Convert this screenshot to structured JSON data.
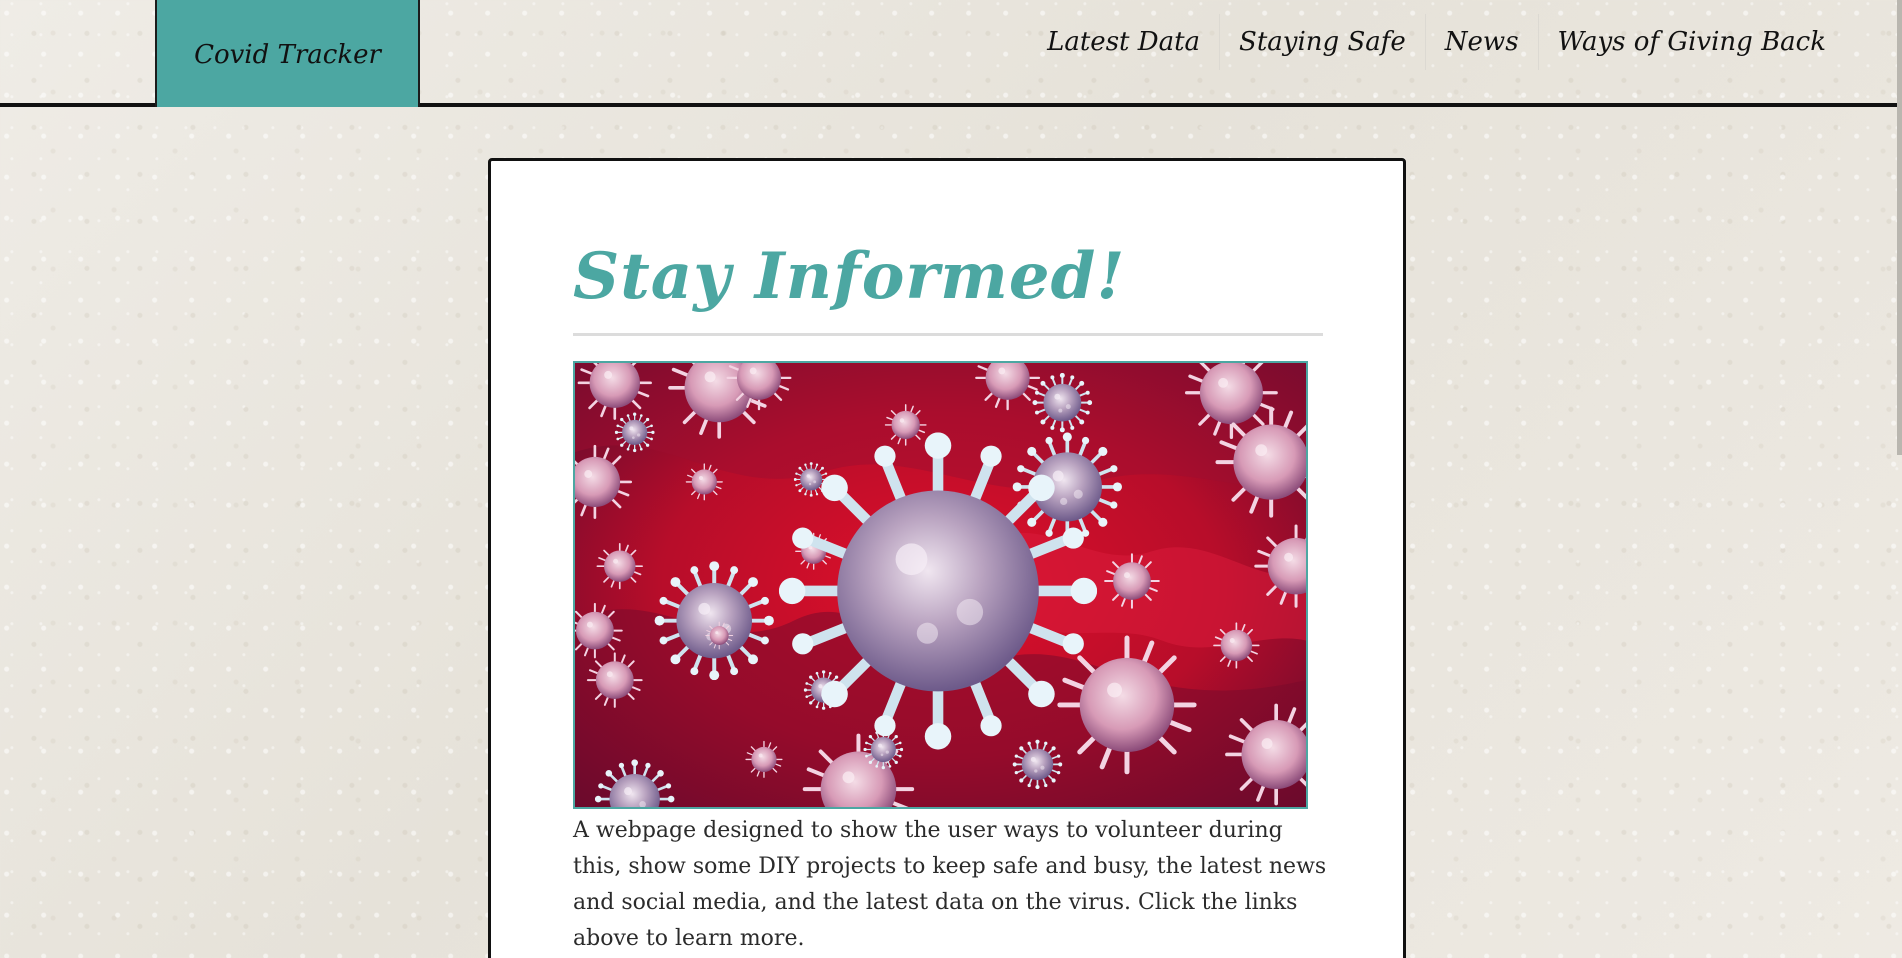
{
  "header": {
    "brand": "Covid Tracker",
    "nav": [
      {
        "label": "Latest Data"
      },
      {
        "label": "Staying Safe"
      },
      {
        "label": "News"
      },
      {
        "label": "Ways of Giving Back"
      }
    ]
  },
  "main": {
    "title": "Stay Informed!",
    "image_alt": "coronavirus-image",
    "description": "A webpage designed to show the user ways to volunteer during this, show some DIY projects to keep safe and busy, the latest news and social media, and the latest data on the virus. Click the links above to learn more."
  },
  "colors": {
    "accent": "#4ca7a2",
    "background": "#ebe7df",
    "card": "#ffffff",
    "border": "#111111",
    "virus_bg": "#c8102e"
  }
}
